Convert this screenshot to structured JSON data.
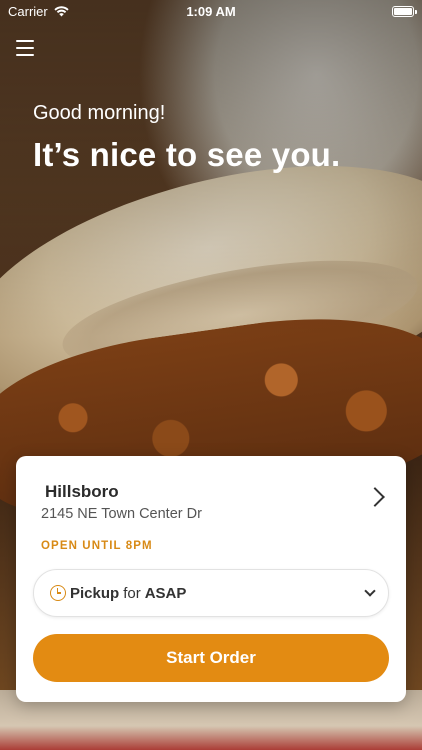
{
  "status_bar": {
    "carrier": "Carrier",
    "time": "1:09 AM"
  },
  "hero": {
    "greeting": "Good morning!",
    "headline": "It’s nice to see you."
  },
  "location_card": {
    "name": "Hillsboro",
    "address": "2145 NE Town Center Dr",
    "hours": "OPEN UNTIL 8PM",
    "pickup": {
      "mode": "Pickup",
      "connector": "for",
      "time": "ASAP"
    },
    "start_label": "Start Order"
  },
  "colors": {
    "accent": "#e38b12",
    "hours_text": "#d88a16"
  }
}
